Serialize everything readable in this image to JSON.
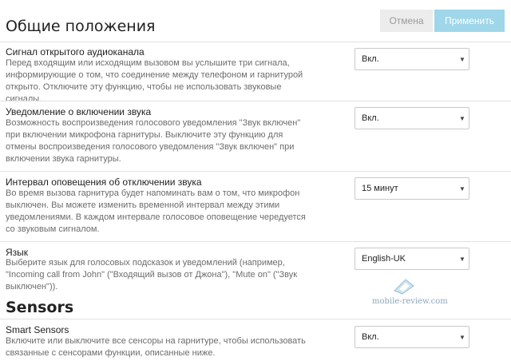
{
  "header": {
    "title": "Общие положения"
  },
  "toolbar": {
    "cancel_label": "Отмена",
    "apply_label": "Применить"
  },
  "settings": [
    {
      "title": "Сигнал открытого аудиоканала",
      "desc": "Перед входящим или исходящим вызовом вы услышите три сигнала, информирующие о том, что соединение между телефоном и гарнитурой открыто. Отключите эту функцию, чтобы не использовать звуковые сигналы.",
      "value": "Вкл."
    },
    {
      "title": "Уведомление о включении звука",
      "desc": "Возможность воспроизведения голосового уведомления \"Звук включен\" при включении микрофона гарнитуры. Выключите эту функцию для отмены воспроизведения голосового уведомления \"Звук включен\" при включении звука гарнитуры.",
      "value": "Вкл."
    },
    {
      "title": "Интервал оповещения об отключении звука",
      "desc": "Во время вызова гарнитура будет напоминать вам о том, что микрофон выключен. Вы можете изменить временной интервал между этими уведомлениями. В каждом интервале голосовое оповещение чередуется со звуковым сигналом.",
      "value": "15 минут"
    },
    {
      "title": "Язык",
      "desc": "Выберите язык для голосовых подсказок и уведомлений (например, \"Incoming call from John\" (\"Входящий вызов от Джона\"), \"Mute on\" (\"Звук выключен\")).",
      "value": "English-UK"
    }
  ],
  "sensors_section": {
    "title": "Sensors",
    "setting": {
      "title": "Smart Sensors",
      "desc": "Включите или выключите все сенсоры на гарнитуре, чтобы использовать связанные с сенсорами функции, описанные ниже.",
      "value": "Вкл."
    }
  },
  "watermark": {
    "text": "mobile-review.com"
  },
  "icons": {
    "dropdown": "caret-down-icon",
    "watermark_logo": "phone-logo-icon"
  },
  "colors": {
    "apply_button": "#9fd6ea",
    "cancel_button": "#ececec",
    "divider": "#e2e2e2"
  }
}
